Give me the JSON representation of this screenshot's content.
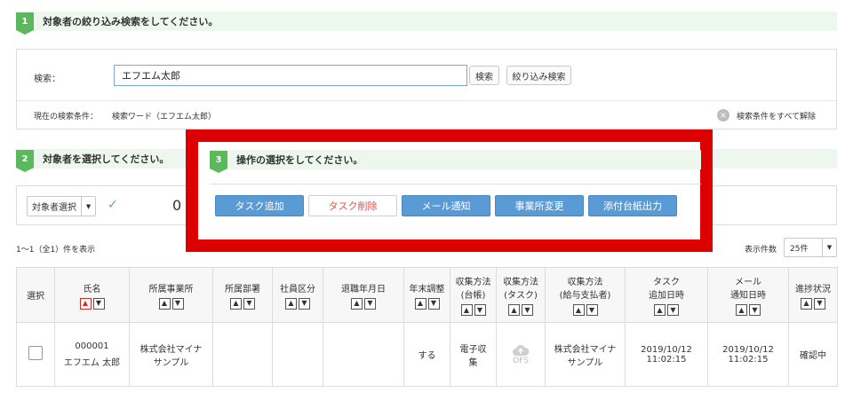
{
  "step1": {
    "num": "1",
    "title": "対象者の絞り込み検索をしてください。"
  },
  "search": {
    "label": "検索：",
    "value": "エフエム太郎",
    "search_button": "検索",
    "filter_button": "絞り込み検索",
    "current_label": "現在の検索条件：",
    "current_value": "検索ワード（エフエム太郎）",
    "clear_label": "検索条件をすべて解除"
  },
  "step2": {
    "num": "2",
    "title": "対象者を選択してください。"
  },
  "select_panel": {
    "select_label": "対象者選択",
    "check": "✓",
    "count": "0"
  },
  "step3": {
    "num": "3",
    "title": "操作の選択をしてください。"
  },
  "operations": {
    "add_task": "タスク追加",
    "delete_task": "タスク削除",
    "mail_notify": "メール通知",
    "office_change": "事業所変更",
    "attach_output": "添付台紙出力"
  },
  "list_info": {
    "range": "1〜1（全1）件を表示",
    "per_page_label": "表示件数",
    "per_page_value": "25件"
  },
  "table": {
    "headers": {
      "select": "選択",
      "name": "氏名",
      "office": "所属事業所",
      "dept": "所属部署",
      "emp_type": "社員区分",
      "retire": "退職年月日",
      "yearend": "年末調整",
      "collect1_a": "収集方法",
      "collect1_b": "(台帳)",
      "collect2_a": "収集方法",
      "collect2_b": "(タスク)",
      "collect3_a": "収集方法",
      "collect3_b": "(給与支払者)",
      "task_a": "タスク",
      "task_b": "追加日時",
      "mail_a": "メール",
      "mail_b": "通知日時",
      "progress": "進捗状況"
    },
    "row": {
      "emp_no": "000001",
      "name": "エフエム 太郎",
      "office_a": "株式会社マイナ",
      "office_b": "サンプル",
      "yearend": "する",
      "collect1_a": "電子収",
      "collect1_b": "集",
      "collect2": "OFS",
      "collect3_a": "株式会社マイナ",
      "collect3_b": "サンプル",
      "task_date": "2019/10/12",
      "task_time": "11:02:15",
      "mail_date": "2019/10/12",
      "mail_time": "11:02:15",
      "progress": "確認中"
    }
  }
}
